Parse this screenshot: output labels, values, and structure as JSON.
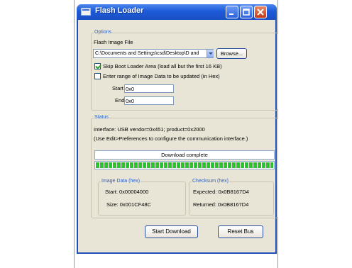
{
  "window": {
    "title": "Flash Loader"
  },
  "options": {
    "group_label": "Options",
    "flash_image_label": "Flash Image File",
    "file_path": "C:\\Documents and Settings\\csd\\Desktop\\D and",
    "browse_label": "Browse...",
    "skip_boot_loader": {
      "label": "Skip Boot Loader Area (load all but the first 16 KB)",
      "checked": true
    },
    "enter_range": {
      "label": "Enter range of Image Data to be updated (in Hex)",
      "checked": false
    },
    "start_label": "Start",
    "start_value": "0x0",
    "end_label": "End",
    "end_value": "0x0"
  },
  "status": {
    "group_label": "Status",
    "interface_text": "Interface: USB vendor=0x451; product=0x2000",
    "hint_text": "(Use Edit>Preferences to configure the communication interface.)",
    "message": "Download complete",
    "progress_percent": 100
  },
  "image_data": {
    "group_label": "Image Data (hex)",
    "start_text": "Start: 0x00004000",
    "size_text": "Size: 0x001CF48C"
  },
  "checksum": {
    "group_label": "Checksum (hex)",
    "expected_text": "Expected: 0x0B8167D4",
    "returned_text": "Returned: 0x0B8167D4"
  },
  "actions": {
    "start_download_label": "Start Download",
    "reset_bus_label": "Reset Bus"
  },
  "colors": {
    "title_bar": "#1d5ad8",
    "progress": "#2ec22e",
    "group_title": "#2a5fc7"
  }
}
